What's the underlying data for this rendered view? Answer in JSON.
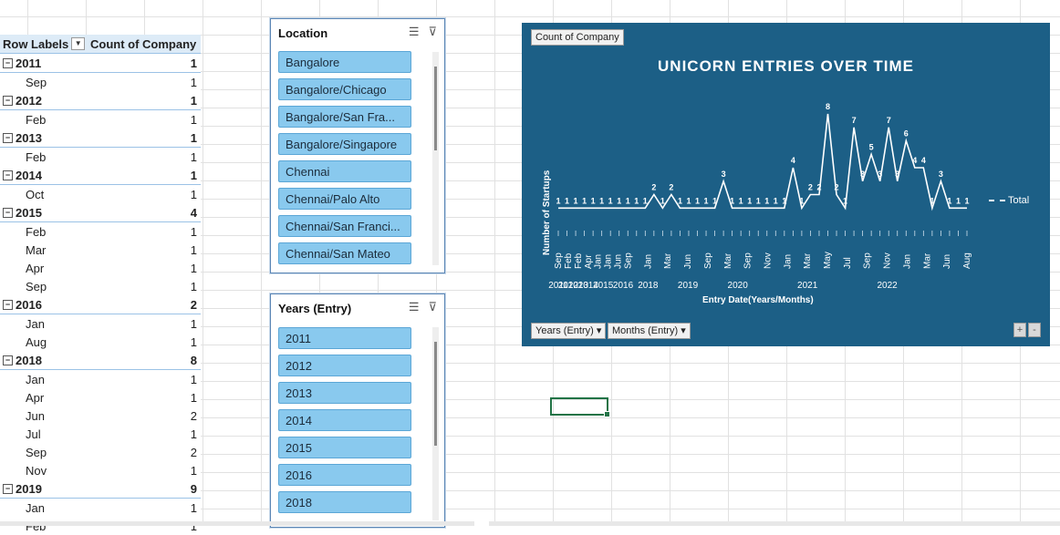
{
  "pivot": {
    "header_row_labels": "Row Labels",
    "header_count": "Count of Company",
    "rows": [
      {
        "label": "2011",
        "value": "1",
        "type": "year"
      },
      {
        "label": "Sep",
        "value": "1",
        "type": "month"
      },
      {
        "label": "2012",
        "value": "1",
        "type": "year"
      },
      {
        "label": "Feb",
        "value": "1",
        "type": "month"
      },
      {
        "label": "2013",
        "value": "1",
        "type": "year"
      },
      {
        "label": "Feb",
        "value": "1",
        "type": "month"
      },
      {
        "label": "2014",
        "value": "1",
        "type": "year"
      },
      {
        "label": "Oct",
        "value": "1",
        "type": "month"
      },
      {
        "label": "2015",
        "value": "4",
        "type": "year"
      },
      {
        "label": "Feb",
        "value": "1",
        "type": "month"
      },
      {
        "label": "Mar",
        "value": "1",
        "type": "month"
      },
      {
        "label": "Apr",
        "value": "1",
        "type": "month"
      },
      {
        "label": "Sep",
        "value": "1",
        "type": "month"
      },
      {
        "label": "2016",
        "value": "2",
        "type": "year"
      },
      {
        "label": "Jan",
        "value": "1",
        "type": "month"
      },
      {
        "label": "Aug",
        "value": "1",
        "type": "month"
      },
      {
        "label": "2018",
        "value": "8",
        "type": "year"
      },
      {
        "label": "Jan",
        "value": "1",
        "type": "month"
      },
      {
        "label": "Apr",
        "value": "1",
        "type": "month"
      },
      {
        "label": "Jun",
        "value": "2",
        "type": "month"
      },
      {
        "label": "Jul",
        "value": "1",
        "type": "month"
      },
      {
        "label": "Sep",
        "value": "2",
        "type": "month"
      },
      {
        "label": "Nov",
        "value": "1",
        "type": "month"
      },
      {
        "label": "2019",
        "value": "9",
        "type": "year"
      },
      {
        "label": "Jan",
        "value": "1",
        "type": "month"
      },
      {
        "label": "Feb",
        "value": "1",
        "type": "month"
      }
    ]
  },
  "location_slicer": {
    "title": "Location",
    "items": [
      "Bangalore",
      "Bangalore/Chicago",
      "Bangalore/San Fra...",
      "Bangalore/Singapore",
      "Chennai",
      "Chennai/Palo Alto",
      "Chennai/San Franci...",
      "Chennai/San Mateo"
    ]
  },
  "years_slicer": {
    "title": "Years (Entry)",
    "items": [
      "2011",
      "2012",
      "2013",
      "2014",
      "2015",
      "2016",
      "2018"
    ]
  },
  "icons": {
    "multiselect": "multi-select-icon",
    "clear_filter": "clear-filter-icon",
    "collapse": "collapse-icon"
  },
  "chart": {
    "field_button": "Count of Company",
    "title": "UNICORN ENTRIES OVER TIME",
    "ylabel": "Number of Startups",
    "xlabel": "Entry Date(Years/Months)",
    "legend": "Total",
    "axis_buttons": [
      "Years (Entry)",
      "Months (Entry)"
    ],
    "plus": "+",
    "minus": "-",
    "bg_color": "#1c5f86"
  },
  "chart_data": {
    "type": "line",
    "title": "UNICORN ENTRIES OVER TIME",
    "xlabel": "Entry Date(Years/Months)",
    "ylabel": "Number of Startups",
    "series": [
      {
        "name": "Total",
        "values": [
          1,
          1,
          1,
          1,
          1,
          1,
          1,
          1,
          1,
          1,
          1,
          2,
          1,
          2,
          1,
          1,
          1,
          1,
          1,
          3,
          1,
          1,
          1,
          1,
          1,
          1,
          1,
          4,
          1,
          2,
          2,
          8,
          2,
          1,
          7,
          3,
          5,
          3,
          7,
          3,
          6,
          4,
          4,
          1,
          3,
          1,
          1,
          1
        ]
      }
    ],
    "month_ticks": [
      {
        "i": 0,
        "label": "Sep"
      },
      {
        "i": 1,
        "label": "Feb"
      },
      {
        "i": 2,
        "label": "Feb"
      },
      {
        "i": 3,
        "label": "Apr"
      },
      {
        "i": 4,
        "label": "Jan"
      },
      {
        "i": 5,
        "label": "Jan"
      },
      {
        "i": 6,
        "label": "Jun"
      },
      {
        "i": 7,
        "label": "Sep"
      },
      {
        "i": 9,
        "label": "Jan"
      },
      {
        "i": 11,
        "label": "Mar"
      },
      {
        "i": 13,
        "label": "Jun"
      },
      {
        "i": 15,
        "label": "Sep"
      },
      {
        "i": 17,
        "label": "Mar"
      },
      {
        "i": 19,
        "label": "Sep"
      },
      {
        "i": 21,
        "label": "Nov"
      },
      {
        "i": 23,
        "label": "Jan"
      },
      {
        "i": 25,
        "label": "Mar"
      },
      {
        "i": 27,
        "label": "May"
      },
      {
        "i": 29,
        "label": "Jul"
      },
      {
        "i": 31,
        "label": "Sep"
      },
      {
        "i": 33,
        "label": "Nov"
      },
      {
        "i": 35,
        "label": "Jan"
      },
      {
        "i": 37,
        "label": "Mar"
      },
      {
        "i": 39,
        "label": "Jun"
      },
      {
        "i": 41,
        "label": "Aug"
      }
    ],
    "year_labels": [
      {
        "label": "2011",
        "i": 0
      },
      {
        "label": "2012",
        "i": 1
      },
      {
        "label": "2013",
        "i": 2
      },
      {
        "label": "2014",
        "i": 3
      },
      {
        "label": "2015",
        "i": 4.5
      },
      {
        "label": "2016",
        "i": 6.5
      },
      {
        "label": "2018",
        "i": 9
      },
      {
        "label": "2019",
        "i": 13
      },
      {
        "label": "2020",
        "i": 18
      },
      {
        "label": "2021",
        "i": 25
      },
      {
        "label": "2022",
        "i": 33
      }
    ]
  }
}
